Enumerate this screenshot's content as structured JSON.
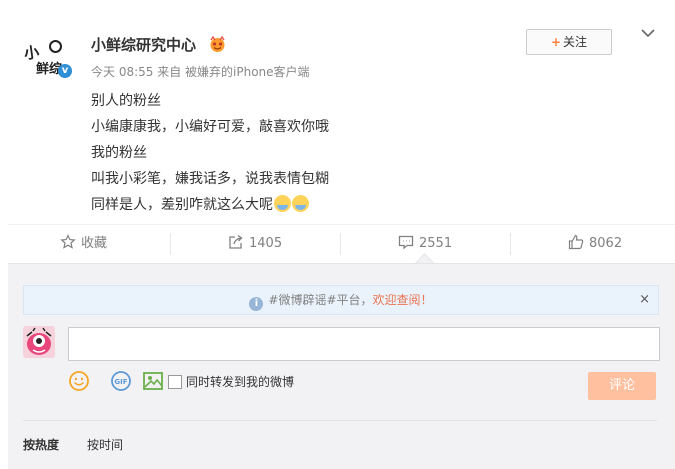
{
  "post": {
    "author": "小鲜综研究中心",
    "avatar_logo_text": "小鲜综",
    "meta": "今天 08:55 来自 被嫌弃的iPhone客户端",
    "follow_label": "关注",
    "content_lines": [
      "别人的粉丝",
      "小编康康我，小编好可爱，敲喜欢你哦",
      "我的粉丝",
      "叫我小彩笔，嫌我话多，说我表情包糊",
      "同样是人，差别咋就这么大呢"
    ]
  },
  "actions": {
    "favorite": "收藏",
    "repost": "1405",
    "comment": "2551",
    "like": "8062"
  },
  "comment_box": {
    "notice_prefix": "#微博辟谣#平台，",
    "notice_link": "欢迎查阅！",
    "close": "×",
    "input_value": "",
    "repost_label": "同时转发到我的微博",
    "submit_label": "评论",
    "gif_label": "GIF"
  },
  "sort": {
    "by_heat": "按热度",
    "by_time": "按时间"
  },
  "icons": [
    "verified-icon",
    "emoji-icon",
    "gif-icon",
    "image-icon",
    "star-icon",
    "repost-icon",
    "comment-icon",
    "thumb-up-icon",
    "info-icon",
    "chevron-down-icon"
  ],
  "colors": {
    "accent": "#ff8140",
    "link": "#eb7350",
    "submit": "#ffc09f",
    "verified": "#2e8fd6"
  }
}
